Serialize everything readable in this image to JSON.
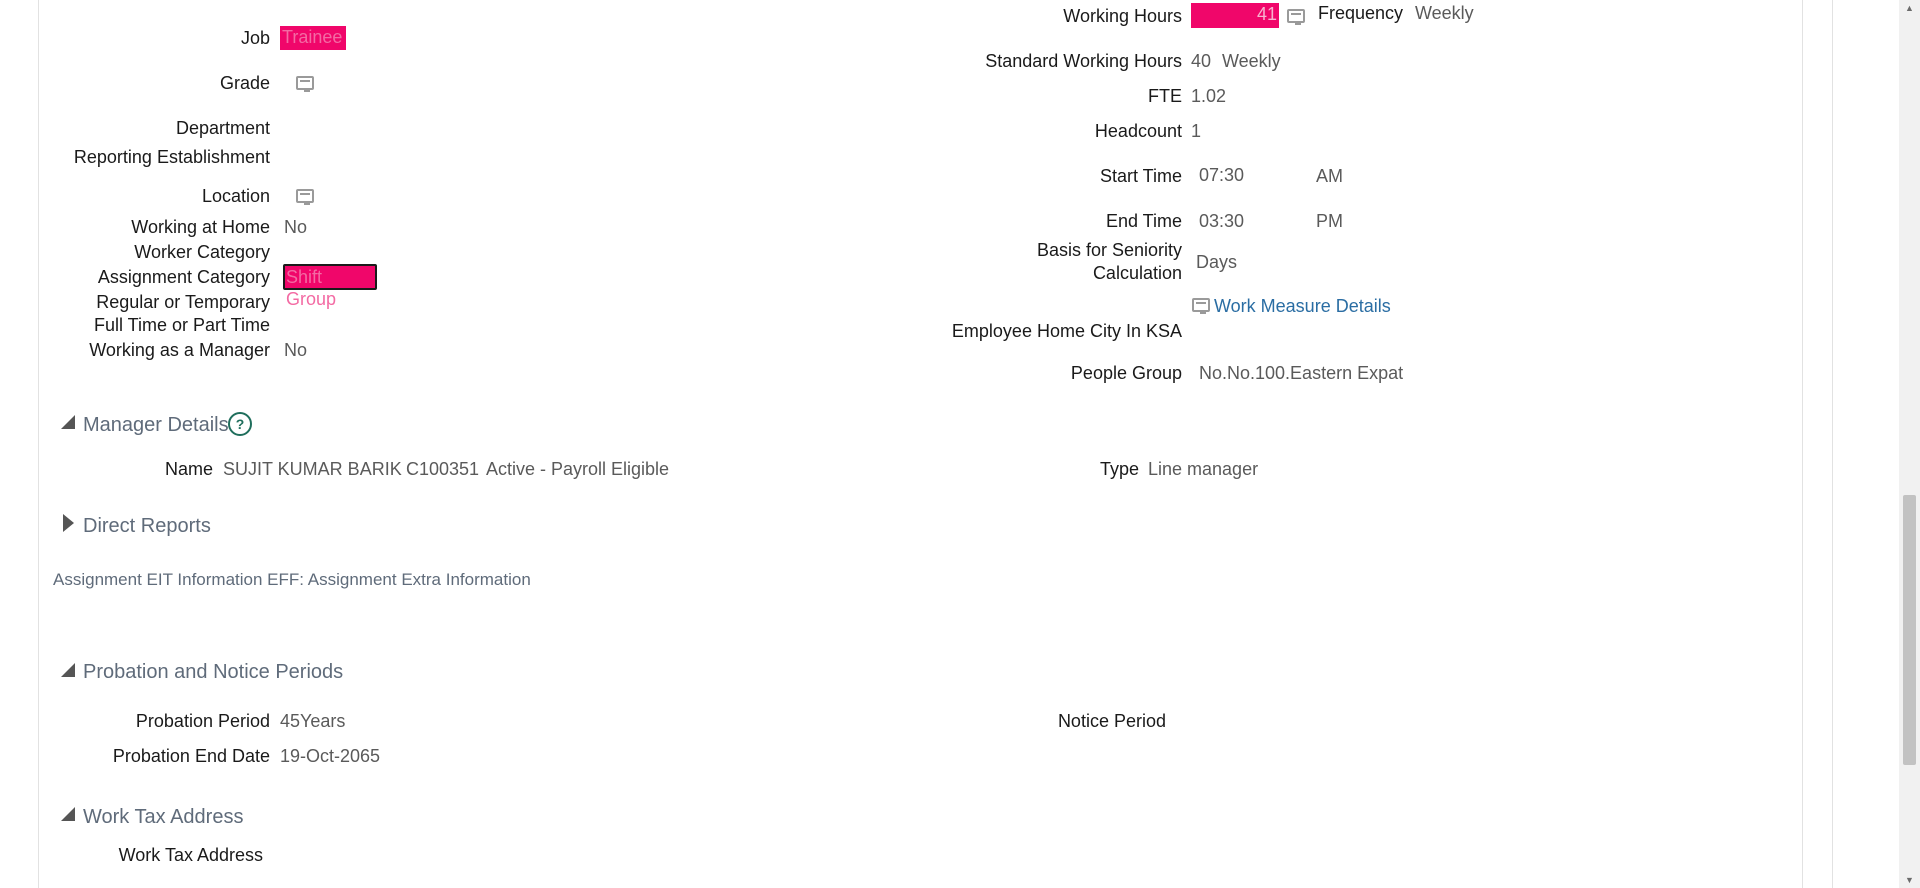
{
  "left_fields": {
    "job": {
      "label": "Job",
      "value": "Trainee"
    },
    "grade": {
      "label": "Grade"
    },
    "department": {
      "label": "Department"
    },
    "reporting_establishment": {
      "label": "Reporting Establishment"
    },
    "location": {
      "label": "Location"
    },
    "working_at_home": {
      "label": "Working at Home",
      "value": "No"
    },
    "worker_category": {
      "label": "Worker Category"
    },
    "assignment_category": {
      "label": "Assignment Category",
      "value": "Shift Group"
    },
    "regular_or_temporary": {
      "label": "Regular or Temporary"
    },
    "full_or_part_time": {
      "label": "Full Time or Part Time"
    },
    "working_as_manager": {
      "label": "Working as a Manager",
      "value": "No"
    }
  },
  "right_fields": {
    "working_hours": {
      "label": "Working Hours",
      "value": "41"
    },
    "frequency": {
      "label": "Frequency",
      "value": "Weekly"
    },
    "standard_working_hours": {
      "label": "Standard Working Hours",
      "value": "40",
      "unit": "Weekly"
    },
    "fte": {
      "label": "FTE",
      "value": "1.02"
    },
    "headcount": {
      "label": "Headcount",
      "value": "1"
    },
    "start_time": {
      "label": "Start Time",
      "value": "07:30",
      "meridiem": "AM"
    },
    "end_time": {
      "label": "End Time",
      "value": "03:30",
      "meridiem": "PM"
    },
    "seniority_basis": {
      "label_line1": "Basis for Seniority",
      "label_line2": "Calculation",
      "value": "Days"
    },
    "work_measure_link": "Work Measure Details",
    "home_city": {
      "label": "Employee Home City In KSA"
    },
    "people_group": {
      "label": "People Group",
      "value": "No.No.100.Eastern Expat"
    }
  },
  "manager_details": {
    "title": "Manager Details",
    "name_label": "Name",
    "name_value": "SUJIT KUMAR BARIK",
    "person_number": "C100351",
    "status": "Active - Payroll Eligible",
    "type_label": "Type",
    "type_value": "Line manager"
  },
  "direct_reports": {
    "title": "Direct Reports"
  },
  "eff": {
    "title": "Assignment EIT Information EFF: Assignment Extra Information"
  },
  "probation": {
    "title": "Probation and Notice Periods",
    "period_label": "Probation Period",
    "period_value": "45Years",
    "end_label": "Probation End Date",
    "end_value": "19-Oct-2065",
    "notice_label": "Notice Period"
  },
  "work_tax": {
    "title": "Work Tax Address",
    "field_label": "Work Tax Address"
  },
  "colors": {
    "highlight": "#f0066a",
    "link": "#2a6da3",
    "help": "#1f6e5c"
  },
  "icons": [
    "details-card-icon",
    "help-icon",
    "collapse-triangle-icon",
    "expand-triangle-icon"
  ]
}
